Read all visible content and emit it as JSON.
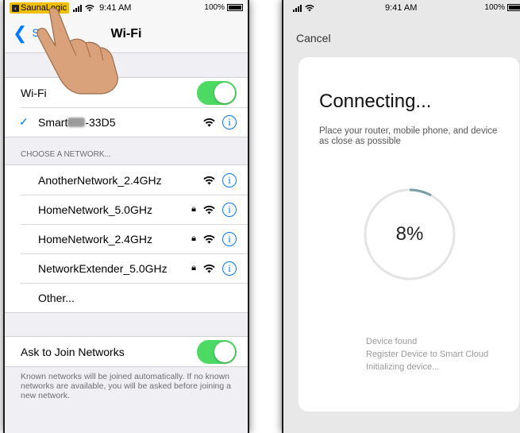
{
  "left_screen": {
    "status_bar": {
      "back_app": "SaunaLogic",
      "time": "9:41 AM",
      "battery": "100%"
    },
    "nav": {
      "back_label": "S",
      "title": "Wi-Fi"
    },
    "wifi_toggle": {
      "label": "Wi-Fi",
      "on": true,
      "color": "#4cd964"
    },
    "connected": {
      "name_prefix": "Smart",
      "name_suffix": "-33D5"
    },
    "section_header": "CHOOSE A NETWORK...",
    "networks": [
      {
        "name": "AnotherNetwork_2.4GHz",
        "locked": false
      },
      {
        "name": "HomeNetwork_5.0GHz",
        "locked": true
      },
      {
        "name": "HomeNetwork_2.4GHz",
        "locked": true
      },
      {
        "name": "NetworkExtender_5.0GHz",
        "locked": true
      }
    ],
    "other_label": "Other...",
    "ask_to_join": {
      "label": "Ask to Join Networks",
      "on": true
    },
    "footer": "Known networks will be joined automatically. If no known networks are available, you will be asked before joining a new network.",
    "accent": "#007aff"
  },
  "right_screen": {
    "status_bar": {
      "time": "9:41 AM",
      "battery": "100%"
    },
    "cancel_label": "Cancel",
    "title": "Connecting...",
    "subtitle": "Place your router, mobile phone, and device as close as possible",
    "progress": {
      "value": 8,
      "label": "8%"
    },
    "steps": [
      "Device found",
      "Register Device to Smart Cloud",
      "Initializing device..."
    ]
  }
}
